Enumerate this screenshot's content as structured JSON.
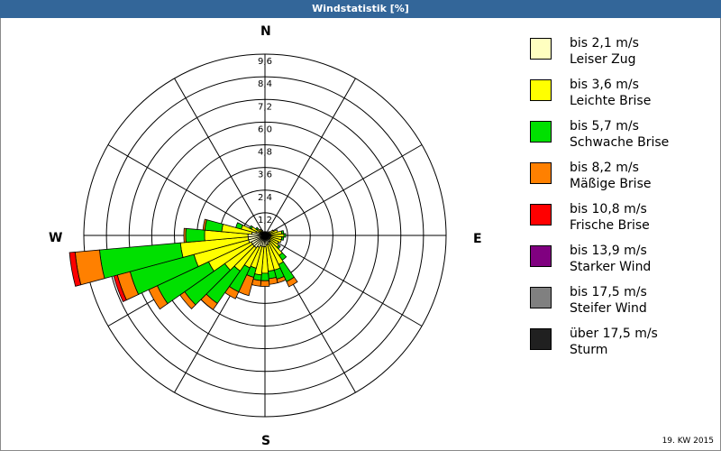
{
  "title": "Windstatistik [%]",
  "footer": "19. KW 2015",
  "compass": {
    "n": "N",
    "e": "E",
    "s": "S",
    "w": "W"
  },
  "chart_data": {
    "type": "wind-rose",
    "title": "Windstatistik [%]",
    "radial_ticks": [
      "1,2",
      "2,4",
      "3,6",
      "4,8",
      "6,0",
      "7,2",
      "8,4",
      "9,6"
    ],
    "radial_max": 9.6,
    "sectors": 36,
    "sector_width_deg": 10,
    "grid": true,
    "legend_position": "right",
    "speed_classes": [
      {
        "range": "bis 2,1 m/s",
        "name": "Leiser Zug",
        "color": "#ffffc0"
      },
      {
        "range": "bis 3,6 m/s",
        "name": "Leichte Brise",
        "color": "#ffff00"
      },
      {
        "range": "bis 5,7 m/s",
        "name": "Schwache Brise",
        "color": "#00e000"
      },
      {
        "range": "bis 8,2 m/s",
        "name": "Mäßige Brise",
        "color": "#ff8000"
      },
      {
        "range": "bis 10,8 m/s",
        "name": "Frische Brise",
        "color": "#ff0000"
      },
      {
        "range": "bis 13,9 m/s",
        "name": "Starker Wind",
        "color": "#800080"
      },
      {
        "range": "bis 17,5 m/s",
        "name": "Steifer Wind",
        "color": "#808080"
      },
      {
        "range": "über 17,5 m/s",
        "name": "Sturm",
        "color": "#202020"
      }
    ],
    "directions_deg": [
      0,
      10,
      20,
      30,
      40,
      50,
      60,
      70,
      80,
      90,
      100,
      110,
      120,
      130,
      140,
      150,
      160,
      170,
      180,
      190,
      200,
      210,
      220,
      230,
      240,
      250,
      260,
      270,
      280,
      290,
      300,
      310,
      320,
      330,
      340,
      350
    ],
    "values": [
      [
        0.1,
        0.1,
        0,
        0,
        0,
        0,
        0,
        0
      ],
      [
        0.1,
        0.1,
        0,
        0,
        0,
        0,
        0,
        0
      ],
      [
        0.1,
        0.1,
        0,
        0,
        0,
        0,
        0,
        0
      ],
      [
        0.1,
        0.1,
        0,
        0,
        0,
        0,
        0,
        0
      ],
      [
        0.1,
        0.1,
        0,
        0,
        0,
        0,
        0,
        0
      ],
      [
        0.1,
        0.2,
        0,
        0,
        0,
        0,
        0,
        0
      ],
      [
        0.2,
        0.3,
        0,
        0,
        0,
        0,
        0,
        0
      ],
      [
        0.2,
        0.5,
        0,
        0,
        0,
        0,
        0,
        0
      ],
      [
        0.3,
        0.6,
        0.1,
        0,
        0,
        0,
        0,
        0
      ],
      [
        0.3,
        0.7,
        0.1,
        0,
        0,
        0,
        0,
        0
      ],
      [
        0.3,
        0.6,
        0.1,
        0,
        0,
        0,
        0,
        0
      ],
      [
        0.3,
        0.6,
        0,
        0,
        0,
        0,
        0,
        0
      ],
      [
        0.3,
        0.5,
        0,
        0,
        0,
        0,
        0,
        0
      ],
      [
        0.3,
        0.6,
        0.1,
        0,
        0,
        0,
        0,
        0
      ],
      [
        0.4,
        0.9,
        0.3,
        0,
        0,
        0,
        0,
        0
      ],
      [
        0.4,
        1.3,
        1.0,
        0.3,
        0,
        0,
        0,
        0
      ],
      [
        0.5,
        1.4,
        0.5,
        0.2,
        0,
        0,
        0,
        0
      ],
      [
        0.5,
        1.4,
        0.4,
        0.3,
        0,
        0,
        0,
        0
      ],
      [
        0.6,
        1.4,
        0.4,
        0.3,
        0,
        0,
        0,
        0
      ],
      [
        0.6,
        1.5,
        0.3,
        0.3,
        0,
        0,
        0,
        0
      ],
      [
        0.6,
        1.2,
        0.5,
        1.0,
        0,
        0,
        0,
        0
      ],
      [
        0.7,
        1.2,
        1.4,
        0.4,
        0,
        0,
        0,
        0
      ],
      [
        0.8,
        1.5,
        2.1,
        0.4,
        0,
        0,
        0,
        0
      ],
      [
        0.8,
        1.8,
        2.6,
        0.3,
        0,
        0,
        0,
        0
      ],
      [
        0.8,
        2.5,
        3.0,
        0.5,
        0,
        0,
        0,
        0
      ],
      [
        0.9,
        3.0,
        3.5,
        0.7,
        0.2,
        0,
        0,
        0
      ],
      [
        0.9,
        3.6,
        4.3,
        1.3,
        0.3,
        0,
        0,
        0
      ],
      [
        0.9,
        2.3,
        1.0,
        0.1,
        0,
        0,
        0,
        0
      ],
      [
        0.7,
        1.6,
        0.9,
        0.1,
        0,
        0,
        0,
        0
      ],
      [
        0.5,
        0.8,
        0.3,
        0,
        0,
        0,
        0,
        0
      ],
      [
        0.3,
        0.5,
        0.1,
        0,
        0,
        0,
        0,
        0
      ],
      [
        0.2,
        0.3,
        0.1,
        0,
        0,
        0,
        0,
        0
      ],
      [
        0.2,
        0.2,
        0,
        0,
        0,
        0,
        0,
        0
      ],
      [
        0.2,
        0.1,
        0,
        0,
        0,
        0,
        0,
        0
      ],
      [
        0.1,
        0.1,
        0,
        0,
        0,
        0,
        0,
        0
      ],
      [
        0.1,
        0.1,
        0,
        0,
        0,
        0,
        0,
        0
      ]
    ]
  }
}
